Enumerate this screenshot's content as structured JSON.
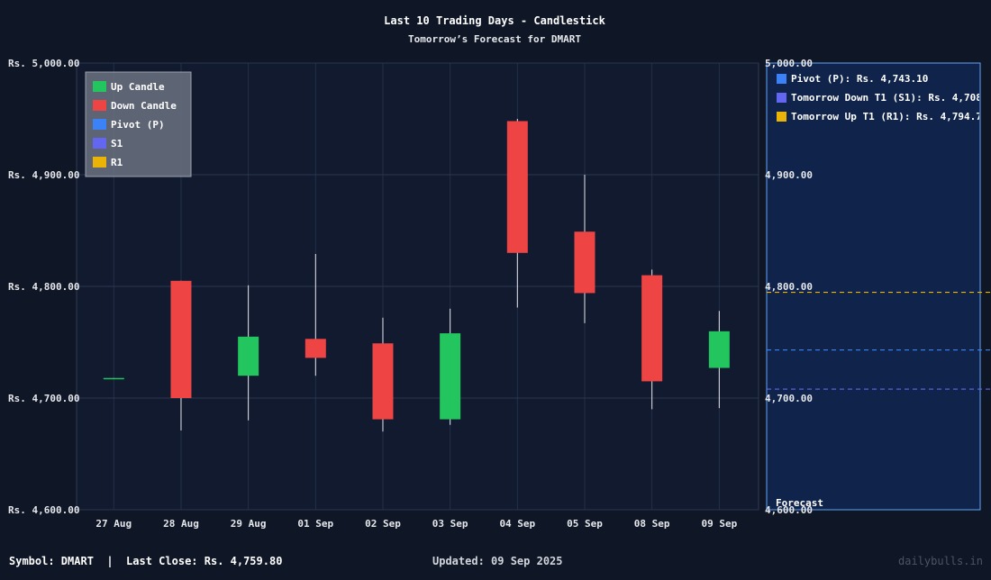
{
  "chart_data": {
    "type": "candlestick",
    "title": "Last 10 Trading Days - Candlestick",
    "subtitle": "Tomorrow’s Forecast for DMART",
    "categories": [
      "27 Aug",
      "28 Aug",
      "29 Aug",
      "01 Sep",
      "02 Sep",
      "03 Sep",
      "04 Sep",
      "05 Sep",
      "08 Sep",
      "09 Sep"
    ],
    "ohlc": [
      {
        "open": 4717.0,
        "high": 4718.0,
        "low": 4717.0,
        "close": 4718.0
      },
      {
        "open": 4805.0,
        "high": 4805.0,
        "low": 4671.0,
        "close": 4700.0
      },
      {
        "open": 4720.0,
        "high": 4801.0,
        "low": 4680.0,
        "close": 4755.0
      },
      {
        "open": 4753.0,
        "high": 4829.0,
        "low": 4720.0,
        "close": 4736.0
      },
      {
        "open": 4749.0,
        "high": 4772.0,
        "low": 4670.0,
        "close": 4681.0
      },
      {
        "open": 4681.0,
        "high": 4780.0,
        "low": 4676.0,
        "close": 4758.0
      },
      {
        "open": 4948.0,
        "high": 4950.0,
        "low": 4781.0,
        "close": 4830.0
      },
      {
        "open": 4849.0,
        "high": 4900.0,
        "low": 4767.0,
        "close": 4794.0
      },
      {
        "open": 4810.0,
        "high": 4815.0,
        "low": 4690.0,
        "close": 4715.0
      },
      {
        "open": 4727.0,
        "high": 4778.0,
        "low": 4691.0,
        "close": 4759.8
      }
    ],
    "ylim": [
      4600,
      5000
    ],
    "yticks": [
      4600,
      4700,
      4800,
      4900,
      5000
    ],
    "ytick_labels": [
      "Rs. 4,600.00",
      "Rs. 4,700.00",
      "Rs. 4,800.00",
      "Rs. 4,900.00",
      "Rs. 5,000.00"
    ],
    "colors": {
      "up": "#22c55e",
      "down": "#ef4444",
      "pivot": "#3b82f6",
      "s1": "#6366f1",
      "r1": "#eab308"
    },
    "legend": {
      "placement": "top-left",
      "items": [
        {
          "label": "Up Candle",
          "color": "#22c55e"
        },
        {
          "label": "Down Candle",
          "color": "#ef4444"
        },
        {
          "label": "Pivot (P)",
          "color": "#3b82f6"
        },
        {
          "label": "S1",
          "color": "#6366f1"
        },
        {
          "label": "R1",
          "color": "#eab308"
        }
      ]
    },
    "forecast": {
      "title": "Forecast",
      "levels": [
        {
          "key": "pivot",
          "label": "Pivot (P): Rs. 4,743.10",
          "value": 4743.1,
          "color": "#3b82f6"
        },
        {
          "key": "s1",
          "label": "Tomorrow Down T1 (S1): Rs. 4,708",
          "value": 4708,
          "color": "#6366f1"
        },
        {
          "key": "r1",
          "label": "Tomorrow Up T1 (R1): Rs. 4,794.7",
          "value": 4794.7,
          "color": "#eab308"
        }
      ]
    },
    "grid": true
  },
  "footer": {
    "symbol": "Symbol: DMART  |  Last Close: Rs. 4,759.80",
    "updated": "Updated: 09 Sep 2025",
    "brand": "dailybulls.in"
  }
}
